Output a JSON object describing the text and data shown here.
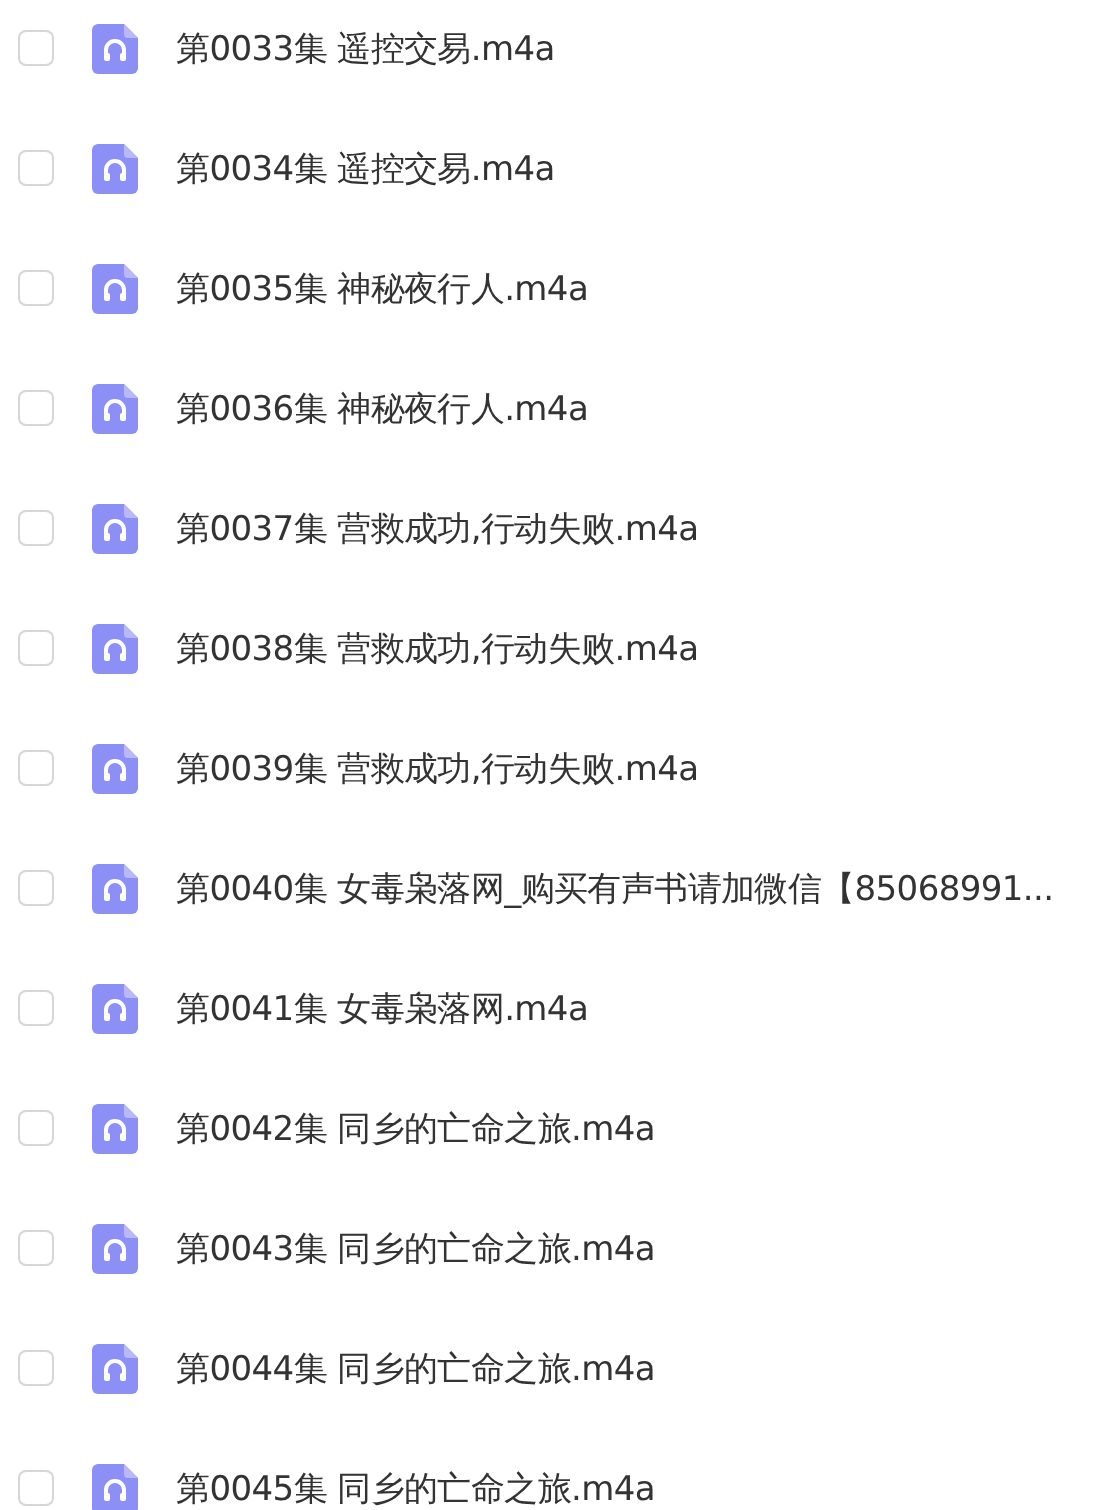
{
  "files": [
    {
      "name": "第0033集 遥控交易.m4a",
      "checked": false
    },
    {
      "name": "第0034集 遥控交易.m4a",
      "checked": false
    },
    {
      "name": "第0035集 神秘夜行人.m4a",
      "checked": false
    },
    {
      "name": "第0036集 神秘夜行人.m4a",
      "checked": false
    },
    {
      "name": "第0037集 营救成功,行动失败.m4a",
      "checked": false
    },
    {
      "name": "第0038集 营救成功,行动失败.m4a",
      "checked": false
    },
    {
      "name": "第0039集 营救成功,行动失败.m4a",
      "checked": false
    },
    {
      "name": "第0040集 女毒枭落网_购买有声书请加微信【85068991...",
      "checked": false
    },
    {
      "name": "第0041集 女毒枭落网.m4a",
      "checked": false
    },
    {
      "name": "第0042集 同乡的亡命之旅.m4a",
      "checked": false
    },
    {
      "name": "第0043集 同乡的亡命之旅.m4a",
      "checked": false
    },
    {
      "name": "第0044集 同乡的亡命之旅.m4a",
      "checked": false
    },
    {
      "name": "第0045集 同乡的亡命之旅.m4a",
      "checked": false
    }
  ]
}
